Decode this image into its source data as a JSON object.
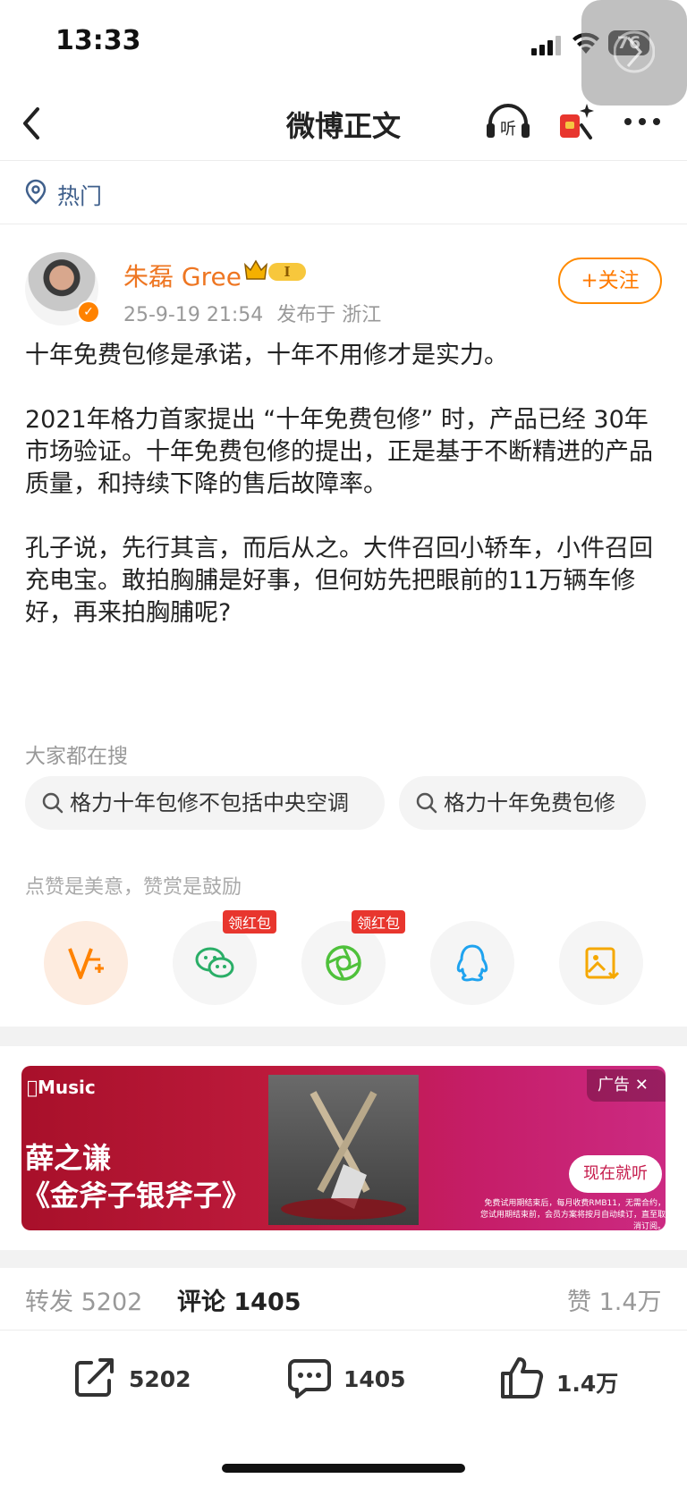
{
  "status_bar": {
    "time": "13:33",
    "battery": "76"
  },
  "nav": {
    "title": "微博正文"
  },
  "hot": {
    "label": "热门"
  },
  "author": {
    "name": "朱磊 Gree",
    "level_badge": "I",
    "date": "25-9-19 21:54",
    "location": "发布于 浙江",
    "follow_label": "+关注"
  },
  "post": {
    "paragraphs": [
      "十年免费包修是承诺，十年不用修才是实力。",
      "2021年格力首家提出 “十年免费包修” 时，产品已经 30年市场验证。十年免费包修的提出，正是基于不断精进的产品质量，和持续下降的售后故障率。",
      "孔子说，先行其言，而后从之。大件召回小轿车，小件召回充电宝。敢拍胸脯是好事，但何妨先把眼前的11万辆车修好，再来拍胸脯呢?"
    ]
  },
  "search": {
    "heading": "大家都在搜",
    "chips": [
      "格力十年包修不包括中央空调",
      "格力十年免费包修"
    ]
  },
  "reward": {
    "note": "点赞是美意，赞赏是鼓励",
    "tag": "领红包"
  },
  "ad": {
    "brand": "Music",
    "label": "广告",
    "artist": "薛之谦",
    "album": "《金斧子银斧子》",
    "cta": "现在就听",
    "fine_print": "免费试用期结束后，每月收费RMB11，无需合约，您试用期结束前，会员方案将按月自动续订，直至取消订阅。"
  },
  "stats": {
    "repost": "转发 5202",
    "comment": "评论 1405",
    "like": "赞 1.4万"
  },
  "actions": {
    "repost": "5202",
    "comment": "1405",
    "like": "1.4万"
  },
  "colors": {
    "accent": "#ff8200",
    "name": "#ee7622",
    "link": "#40608c"
  }
}
